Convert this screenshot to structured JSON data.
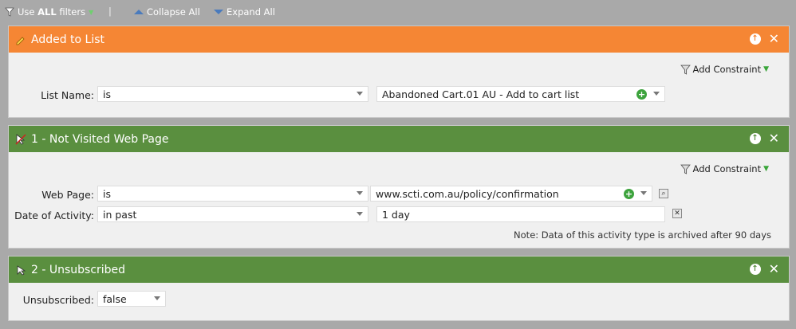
{
  "toolbar": {
    "use_prefix": "Use ",
    "use_all": "ALL",
    "use_suffix": " filters",
    "separator": "|",
    "collapse_label": "Collapse All",
    "expand_label": "Expand All"
  },
  "filters": [
    {
      "title": "Added to List",
      "color": "#f58634",
      "add_constraint_label": "Add Constraint",
      "rows": [
        {
          "label": "List Name:",
          "operator": "is",
          "value": "Abandoned Cart.01 AU - Add to cart list"
        }
      ]
    },
    {
      "title": "1 - Not Visited Web Page",
      "color": "#5a8f3f",
      "add_constraint_label": "Add Constraint",
      "rows": [
        {
          "label": "Web Page:",
          "operator": "is",
          "value": "www.scti.com.au/policy/confirmation"
        },
        {
          "label": "Date of Activity:",
          "operator": "in past",
          "value": "1 day"
        }
      ],
      "note": "Note: Data of this activity type is archived after 90 days"
    },
    {
      "title": "2 - Unsubscribed",
      "color": "#5a8f3f",
      "rows": [
        {
          "label": "Unsubscribed:",
          "operator": "false"
        }
      ]
    }
  ],
  "icons": {
    "filter": "filter-icon",
    "collapse": "triangle-up-icon",
    "expand": "triangle-down-icon",
    "move_up": "arrow-up-circle-icon",
    "remove": "close-icon",
    "add": "plus-circle-icon",
    "browse": "browse-icon",
    "clear": "clear-icon"
  }
}
